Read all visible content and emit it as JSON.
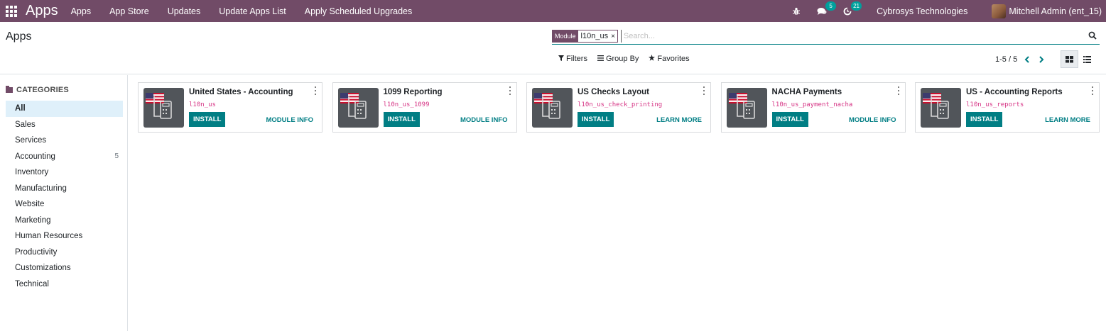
{
  "navbar": {
    "app_name": "Apps",
    "menu": [
      "Apps",
      "App Store",
      "Updates",
      "Update Apps List",
      "Apply Scheduled Upgrades"
    ],
    "messages_count": "5",
    "activities_count": "21",
    "company": "Cybrosys Technologies",
    "user": "Mitchell Admin (ent_15)"
  },
  "control_panel": {
    "title": "Apps",
    "facet_label": "Module",
    "facet_value": "l10n_us",
    "facet_remove": "×",
    "search_placeholder": "Search...",
    "filters_label": "Filters",
    "groupby_label": "Group By",
    "favorites_label": "Favorites",
    "pager": "1-5 / 5"
  },
  "sidebar": {
    "header": "CATEGORIES",
    "categories": [
      {
        "label": "All",
        "count": "",
        "active": true
      },
      {
        "label": "Sales",
        "count": ""
      },
      {
        "label": "Services",
        "count": ""
      },
      {
        "label": "Accounting",
        "count": "5"
      },
      {
        "label": "Inventory",
        "count": ""
      },
      {
        "label": "Manufacturing",
        "count": ""
      },
      {
        "label": "Website",
        "count": ""
      },
      {
        "label": "Marketing",
        "count": ""
      },
      {
        "label": "Human Resources",
        "count": ""
      },
      {
        "label": "Productivity",
        "count": ""
      },
      {
        "label": "Customizations",
        "count": ""
      },
      {
        "label": "Technical",
        "count": ""
      }
    ]
  },
  "cards": [
    {
      "title": "United States - Accounting",
      "technical": "l10n_us",
      "button": "INSTALL",
      "link": "MODULE INFO"
    },
    {
      "title": "1099 Reporting",
      "technical": "l10n_us_1099",
      "button": "INSTALL",
      "link": "MODULE INFO"
    },
    {
      "title": "US Checks Layout",
      "technical": "l10n_us_check_printing",
      "button": "INSTALL",
      "link": "LEARN MORE"
    },
    {
      "title": "NACHA Payments",
      "technical": "l10n_us_payment_nacha",
      "button": "INSTALL",
      "link": "MODULE INFO"
    },
    {
      "title": "US - Accounting Reports",
      "technical": "l10n_us_reports",
      "button": "INSTALL",
      "link": "LEARN MORE"
    }
  ],
  "colors": {
    "brand": "#714B67",
    "accent": "#017e84",
    "badge": "#00A09D",
    "technical_name": "#d63384"
  }
}
